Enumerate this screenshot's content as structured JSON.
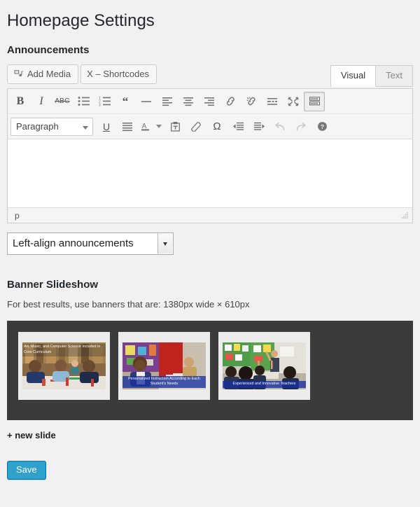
{
  "page": {
    "title": "Homepage Settings"
  },
  "announcements": {
    "heading": "Announcements",
    "add_media_label": "Add Media",
    "shortcodes_label": "X – Shortcodes",
    "tabs": [
      {
        "label": "Visual",
        "active": true
      },
      {
        "label": "Text",
        "active": false
      }
    ],
    "toolbar_row1": [
      {
        "name": "bold-icon",
        "label": "B",
        "active": false
      },
      {
        "name": "italic-icon",
        "label": "I",
        "active": false
      },
      {
        "name": "strikethrough-icon",
        "label": "ABC",
        "active": false
      },
      {
        "name": "unordered-list-icon",
        "label": "",
        "active": false
      },
      {
        "name": "ordered-list-icon",
        "label": "",
        "active": false
      },
      {
        "name": "blockquote-icon",
        "label": "“",
        "active": false
      },
      {
        "name": "horizontal-rule-icon",
        "label": "",
        "active": false
      },
      {
        "name": "align-left-icon",
        "label": "",
        "active": false
      },
      {
        "name": "align-center-icon",
        "label": "",
        "active": false
      },
      {
        "name": "align-right-icon",
        "label": "",
        "active": false
      },
      {
        "name": "link-icon",
        "label": "",
        "active": false
      },
      {
        "name": "unlink-icon",
        "label": "",
        "active": false
      },
      {
        "name": "read-more-icon",
        "label": "",
        "active": false
      },
      {
        "name": "fullscreen-icon",
        "label": "",
        "active": false
      },
      {
        "name": "toolbar-toggle-icon",
        "label": "",
        "active": true
      }
    ],
    "format_select": {
      "value": "Paragraph"
    },
    "toolbar_row2": [
      {
        "name": "underline-icon",
        "label": "U",
        "active": false
      },
      {
        "name": "justify-icon",
        "label": "",
        "active": false
      },
      {
        "name": "text-color-icon",
        "label": "A",
        "active": false
      },
      {
        "name": "paste-as-text-icon",
        "label": "",
        "active": false
      },
      {
        "name": "clear-formatting-icon",
        "label": "",
        "active": false
      },
      {
        "name": "special-character-icon",
        "label": "Ω",
        "active": false
      },
      {
        "name": "outdent-icon",
        "label": "",
        "active": false
      },
      {
        "name": "indent-icon",
        "label": "",
        "active": false
      },
      {
        "name": "undo-icon",
        "label": "",
        "active": false,
        "disabled": true
      },
      {
        "name": "redo-icon",
        "label": "",
        "active": false,
        "disabled": true
      },
      {
        "name": "help-icon",
        "label": "?",
        "active": false
      }
    ],
    "editor_content": "",
    "statusbar_path": "p",
    "align_select_value": "Left-align announcements"
  },
  "banner": {
    "heading": "Banner Slideshow",
    "help_text": "For best results, use banners that are: 1380px wide × 610px",
    "slides": [
      {
        "caption": "Art, Music, and Computer Science included in Core Curriculum",
        "caption_position": "top"
      },
      {
        "caption": "Personalized Instruction According to Each Student's Needs",
        "caption_position": "bottom"
      },
      {
        "caption": "Experienced and Innovative Teachers",
        "caption_position": "bottom"
      }
    ],
    "new_slide_label": "+ new slide"
  },
  "footer": {
    "save_label": "Save"
  },
  "colors": {
    "page_background": "#f1f1f1",
    "slideshow_background": "#3b3b3b",
    "save_button": "#2ea2cc",
    "save_button_border": "#0074a2",
    "caption_overlay": "#1830a0"
  }
}
